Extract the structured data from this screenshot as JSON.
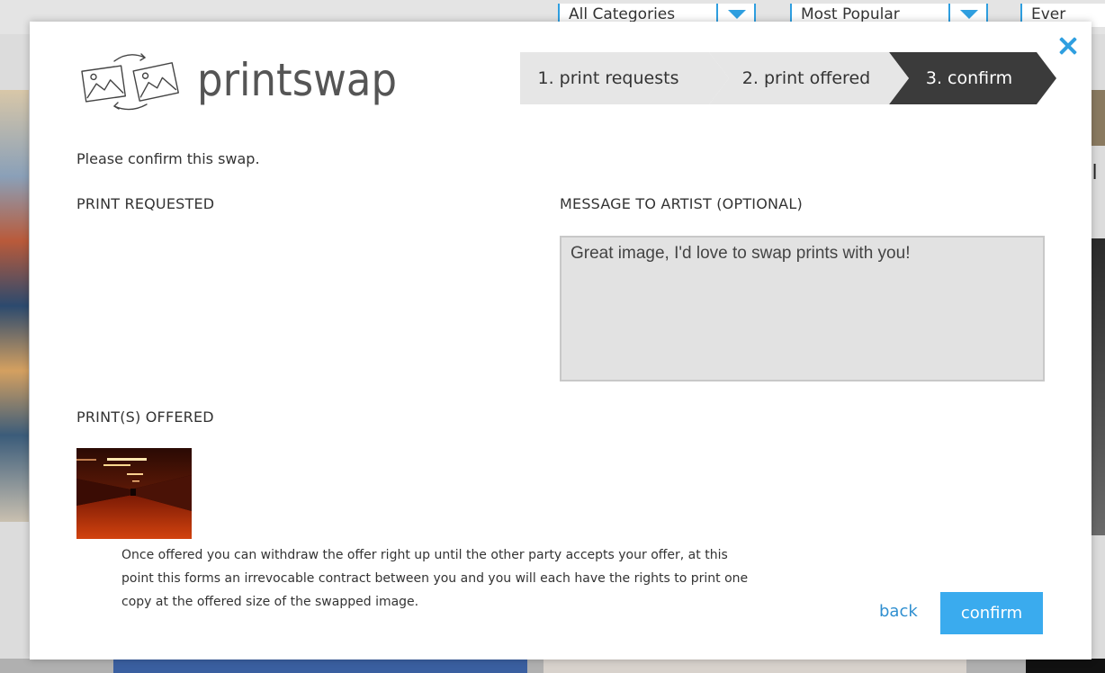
{
  "background": {
    "filters": [
      "All Categories",
      "Most Popular",
      "Ever"
    ],
    "right_partial_text": "ol"
  },
  "modal": {
    "logo_text": "printswap",
    "steps": [
      {
        "label": "1. print requests",
        "active": false
      },
      {
        "label": "2. print offered",
        "active": false
      },
      {
        "label": "3. confirm",
        "active": true
      }
    ],
    "intro": "Please confirm this swap.",
    "print_requested_label": "PRINT REQUESTED",
    "message_label": "MESSAGE TO ARTIST (OPTIONAL)",
    "message_value": "Great image, I'd love to swap prints with you!",
    "prints_offered_label": "PRINT(S) OFFERED",
    "disclaimer": "Once offered you can withdraw the offer right up until the other party accepts your offer, at this point this forms an irrevocable contract between you and you will each have the rights to print one copy at the offered size of the swapped image.",
    "back_label": "back",
    "confirm_label": "confirm"
  },
  "colors": {
    "accent": "#3aabee",
    "active_step": "#3b3b3b",
    "inactive_step": "#e6e6e6",
    "close": "#2f9fe0"
  }
}
